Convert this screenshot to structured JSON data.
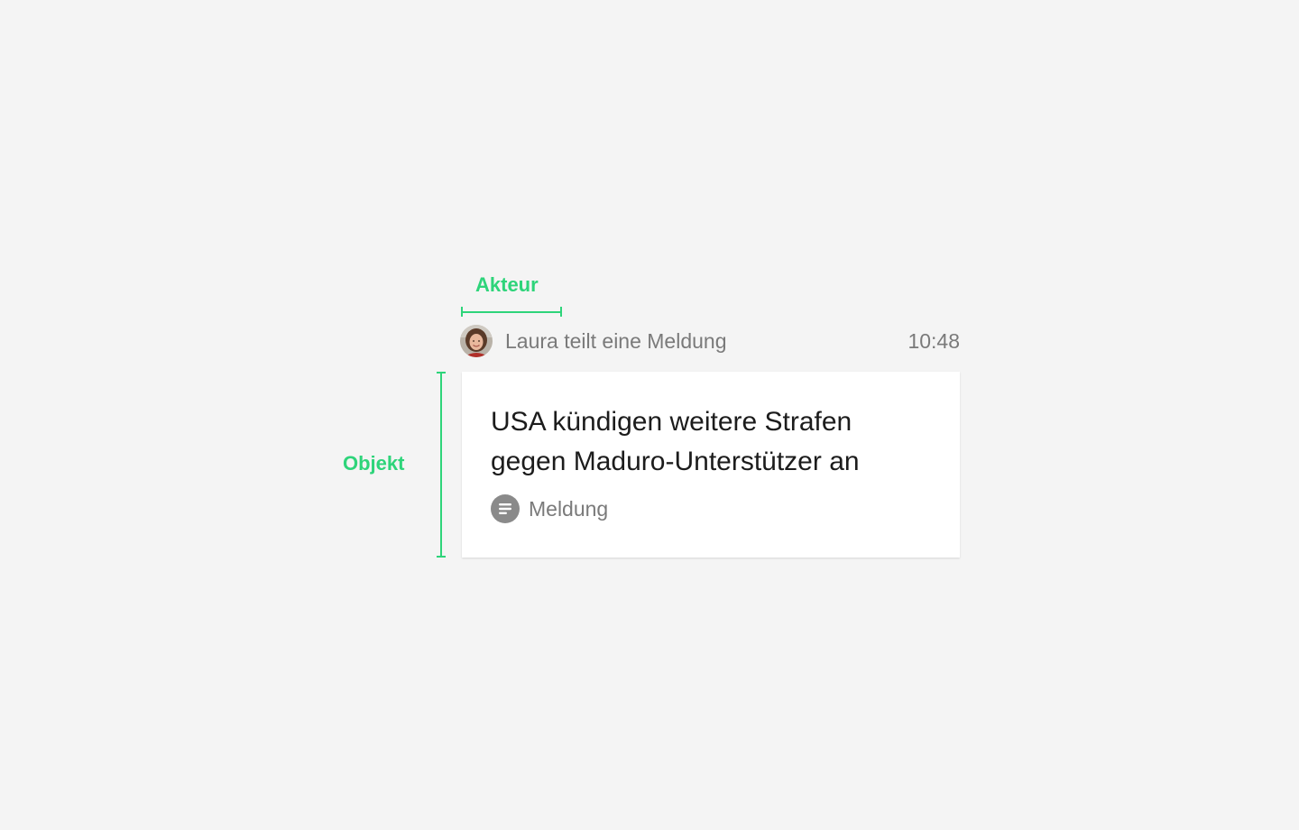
{
  "annotations": {
    "actor_label": "Akteur",
    "object_label": "Objekt",
    "accent_color": "#2ed47a"
  },
  "activity": {
    "avatar_icon": "user-avatar",
    "actor_text": "Laura teilt eine Meldung",
    "time": "10:48"
  },
  "card": {
    "title": "USA kündigen weitere Strafen gegen Maduro-Unterstützer an",
    "type_icon": "document-lines-icon",
    "type_label": "Meldung"
  }
}
